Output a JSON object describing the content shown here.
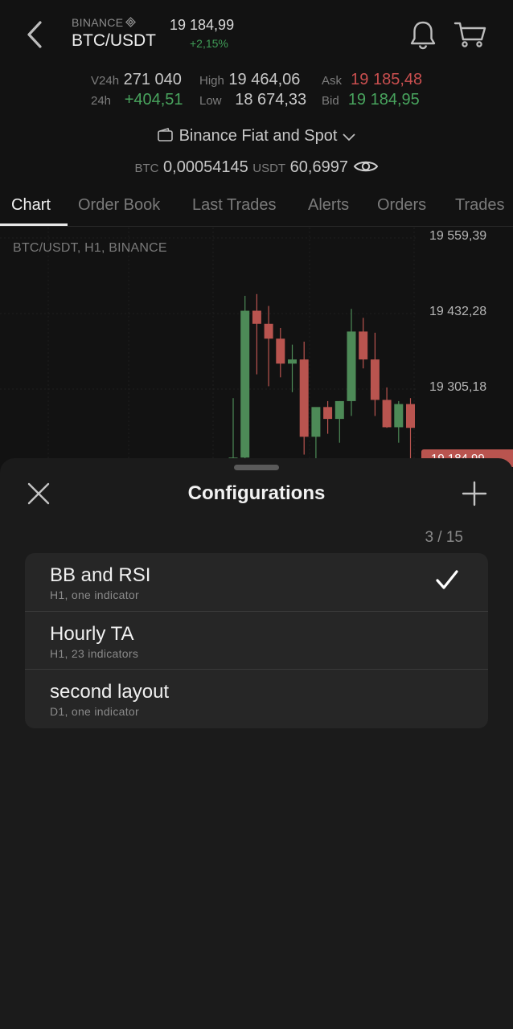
{
  "header": {
    "exchange": "BINANCE",
    "pair": "BTC/USDT",
    "price": "19 184,99",
    "change": "+2,15%"
  },
  "stats": {
    "v24h_label": "V24h",
    "v24h_value": "271 040",
    "h24_label": "24h",
    "h24_value": "+404,51",
    "high_label": "High",
    "high_value": "19 464,06",
    "low_label": "Low",
    "low_value": "18 674,33",
    "ask_label": "Ask",
    "ask_value": "19 185,48",
    "bid_label": "Bid",
    "bid_value": "19 184,95"
  },
  "account": {
    "name": "Binance Fiat and Spot"
  },
  "balance": {
    "btc_label": "BTC",
    "btc_value": "0,00054145",
    "usdt_label": "USDT",
    "usdt_value": "60,6997"
  },
  "tabs": [
    "Chart",
    "Order Book",
    "Last Trades",
    "Alerts",
    "Orders",
    "Trades"
  ],
  "chart": {
    "title": "BTC/USDT, H1, BINANCE",
    "price_labels": [
      "19 559,39",
      "19 432,28",
      "19 305,18"
    ],
    "current_label": "19 184,99"
  },
  "chart_data": {
    "type": "candlestick",
    "up_color": "#4d8a57",
    "down_color": "#b9544f",
    "y_axis": [
      "19 559,39",
      "19 432,28",
      "19 305,18"
    ],
    "candles": [
      {
        "o": 19185,
        "h": 19290,
        "l": 19170,
        "c": 19190
      },
      {
        "o": 19190,
        "h": 19462,
        "l": 19170,
        "c": 19437
      },
      {
        "o": 19437,
        "h": 19465,
        "l": 19330,
        "c": 19415
      },
      {
        "o": 19415,
        "h": 19445,
        "l": 19310,
        "c": 19390
      },
      {
        "o": 19390,
        "h": 19408,
        "l": 19325,
        "c": 19348
      },
      {
        "o": 19348,
        "h": 19380,
        "l": 19300,
        "c": 19355
      },
      {
        "o": 19355,
        "h": 19385,
        "l": 19195,
        "c": 19225
      },
      {
        "o": 19225,
        "h": 19265,
        "l": 19180,
        "c": 19275
      },
      {
        "o": 19275,
        "h": 19285,
        "l": 19230,
        "c": 19255
      },
      {
        "o": 19255,
        "h": 19285,
        "l": 19215,
        "c": 19285
      },
      {
        "o": 19285,
        "h": 19440,
        "l": 19260,
        "c": 19402
      },
      {
        "o": 19402,
        "h": 19425,
        "l": 19340,
        "c": 19355
      },
      {
        "o": 19355,
        "h": 19400,
        "l": 19260,
        "c": 19287
      },
      {
        "o": 19287,
        "h": 19308,
        "l": 19240,
        "c": 19241
      },
      {
        "o": 19241,
        "h": 19285,
        "l": 19215,
        "c": 19280
      },
      {
        "o": 19280,
        "h": 19290,
        "l": 19188,
        "c": 19240
      }
    ]
  },
  "sheet": {
    "title": "Configurations",
    "count": "3 / 15",
    "items": [
      {
        "name": "BB and RSI",
        "sub": "H1, one indicator"
      },
      {
        "name": "Hourly TA",
        "sub": "H1, 23 indicators"
      },
      {
        "name": "second layout",
        "sub": "D1, one indicator"
      }
    ]
  }
}
